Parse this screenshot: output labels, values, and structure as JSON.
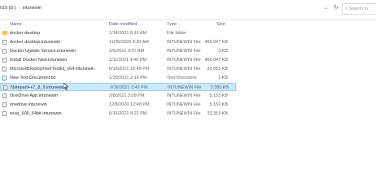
{
  "address": {
    "drive": "019 (D:)",
    "folder": "intunewin",
    "search_placeholder": "Search in"
  },
  "columns": {
    "name": "Name",
    "date": "Date modified",
    "type": "Type",
    "size": "Size"
  },
  "files": [
    {
      "name": "docker desktop",
      "date": "1/14/2021 8:16 AM",
      "type": "File folder",
      "size": "",
      "icon": "folder-icon"
    },
    {
      "name": "docker desktop.intunewin",
      "date": "11/25/2020 8:20 AM",
      "type": "INTUNEWIN File",
      "size": "466,047 KB",
      "icon": "file-icon"
    },
    {
      "name": "Docker Update Service.intunewin",
      "date": "1/6/2021 9:07 AM",
      "type": "INTUNEWIN File",
      "size": "3 KB",
      "icon": "file-icon"
    },
    {
      "name": "Install Docker New.intunewin",
      "date": "1/11/2021 4:40 PM",
      "type": "INTUNEWIN File",
      "size": "466,047 KB",
      "icon": "file-icon"
    },
    {
      "name": "MicrosoftDeploymentToolkit_x64.intunewin",
      "date": "6/16/2021 10:48 PM",
      "type": "INTUNEWIN File",
      "size": "20,651 KB",
      "icon": "file-icon"
    },
    {
      "name": "New Text Document.txt",
      "date": "1/30/2021 2:19 PM",
      "type": "Text Document",
      "size": "1 KB",
      "icon": "text-doc-icon"
    },
    {
      "name": "Notepad++7_8_9.intunewin",
      "date": "6/16/2021 3:42 PM",
      "type": "INTUNEWIN File",
      "size": "3,385 KB",
      "icon": "file-icon",
      "selected": true
    },
    {
      "name": "OneDrive App.intunewin",
      "date": "2/8/2021 3:09 PM",
      "type": "INTUNEWIN File",
      "size": "5,153 KB",
      "icon": "file-icon"
    },
    {
      "name": "onedrive.intunewin",
      "date": "12/8/2020 12:48 PM",
      "type": "INTUNEWIN File",
      "size": "5,152 KB",
      "icon": "file-icon"
    },
    {
      "name": "wvar_600_64bit.intunewin",
      "date": "6/16/2021 8:22 PM",
      "type": "INTUNEWIN File",
      "size": "33,353 KB",
      "icon": "file-icon"
    }
  ]
}
